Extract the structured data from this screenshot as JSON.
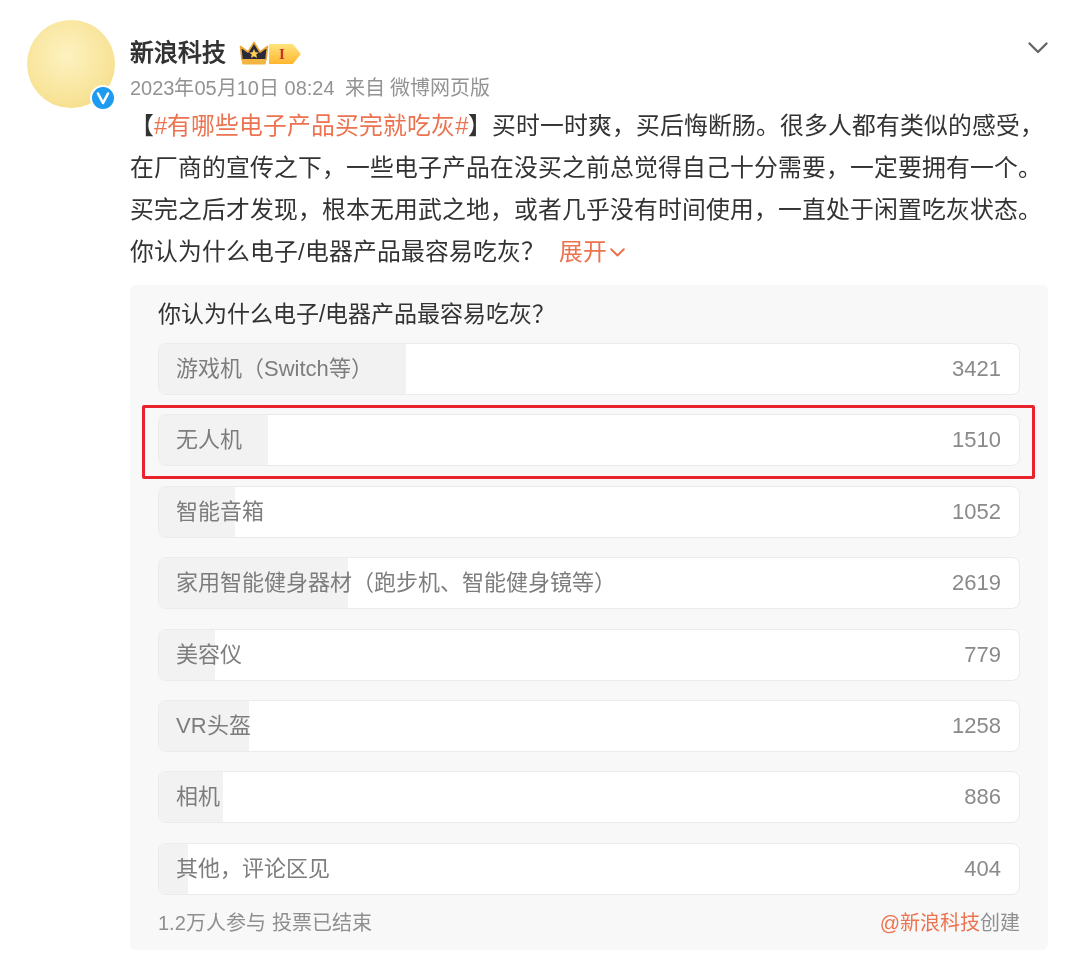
{
  "post": {
    "author": {
      "name": "新浪科技",
      "verified": true,
      "member_level": "I"
    },
    "time": "2023年05月10日 08:24",
    "source": "来自 微博网页版",
    "body": [
      {
        "kind": "text",
        "text": "【"
      },
      {
        "kind": "hashtag",
        "text": "#有哪些电子产品买完就吃灰#"
      },
      {
        "kind": "text",
        "text": "】买时一时爽，买后悔断肠。很多人都有类似的感受，在厂商的宣传之下，一些电子产品在没买之前总觉得自己十分需要，一定要拥有一个。买完之后才发现，根本无用武之地，或者几乎没有时间使用，一直处于闲置吃灰状态。你认为什么电子/电器产品最容易吃灰？"
      }
    ],
    "expand_link": "展开"
  },
  "poll": {
    "title": "你认为什么电子/电器产品最容易吃灰？",
    "options": [
      {
        "label": "游戏机（Switch等）",
        "count": "3421",
        "level": 0.287,
        "highlighted": false
      },
      {
        "label": "无人机",
        "count": "1510",
        "level": 0.127,
        "highlighted": true
      },
      {
        "label": "智能音箱",
        "count": "1052",
        "level": 0.088,
        "highlighted": false
      },
      {
        "label": "家用智能健身器材（跑步机、智能健身镜等）",
        "count": "2619",
        "level": 0.22,
        "highlighted": false
      },
      {
        "label": "美容仪",
        "count": "779",
        "level": 0.065,
        "highlighted": false
      },
      {
        "label": "VR头盔",
        "count": "1258",
        "level": 0.105,
        "highlighted": false
      },
      {
        "label": "相机",
        "count": "886",
        "level": 0.074,
        "highlighted": false
      },
      {
        "label": "其他，评论区见",
        "count": "404",
        "level": 0.034,
        "highlighted": false
      }
    ],
    "participants": "1.2万人参与",
    "status": "投票已结束",
    "creator": "@新浪科技",
    "creator_suffix": "创建"
  }
}
